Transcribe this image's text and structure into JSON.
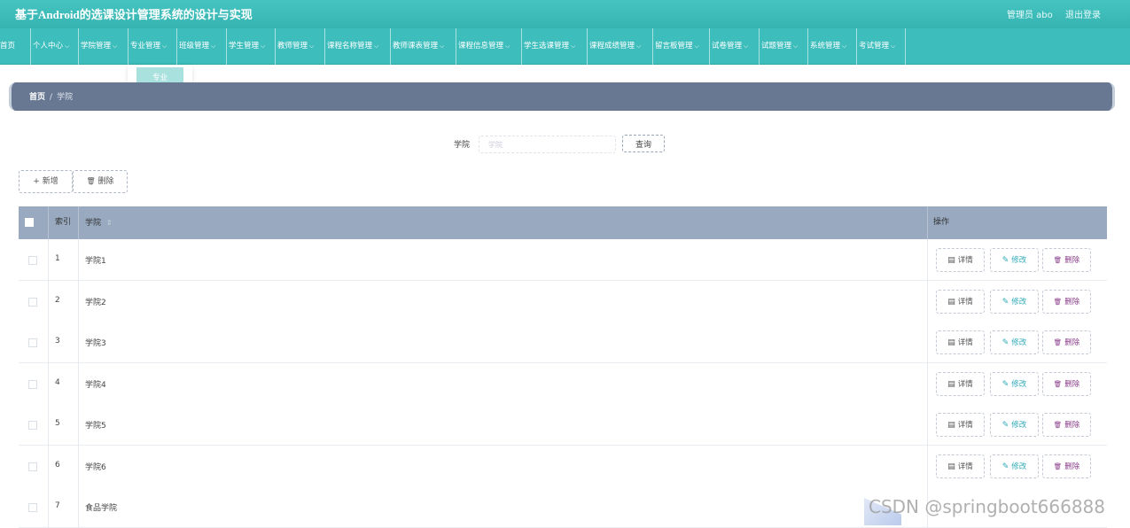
{
  "app": {
    "title": "基于Android的选课设计管理系统的设计与实现",
    "user_label": "管理员 abo",
    "logout_label": "退出登录"
  },
  "nav": {
    "items": [
      {
        "label": "首页",
        "has_dropdown": false
      },
      {
        "label": "个人中心",
        "has_dropdown": true
      },
      {
        "label": "学院管理",
        "has_dropdown": true
      },
      {
        "label": "专业管理",
        "has_dropdown": true
      },
      {
        "label": "班级管理",
        "has_dropdown": true
      },
      {
        "label": "学生管理",
        "has_dropdown": true
      },
      {
        "label": "教师管理",
        "has_dropdown": true
      },
      {
        "label": "课程名称管理",
        "has_dropdown": true
      },
      {
        "label": "教师课表管理",
        "has_dropdown": true
      },
      {
        "label": "课程信息管理",
        "has_dropdown": true
      },
      {
        "label": "学生选课管理",
        "has_dropdown": true
      },
      {
        "label": "课程成绩管理",
        "has_dropdown": true
      },
      {
        "label": "留言板管理",
        "has_dropdown": true
      },
      {
        "label": "试卷管理",
        "has_dropdown": true
      },
      {
        "label": "试题管理",
        "has_dropdown": true
      },
      {
        "label": "系统管理",
        "has_dropdown": true
      },
      {
        "label": "考试管理",
        "has_dropdown": true
      }
    ],
    "chevron": "⌵",
    "open_dropdown": {
      "item_label": "专业"
    }
  },
  "breadcrumb": {
    "home": "首页",
    "separator": "/",
    "current": "学院"
  },
  "search": {
    "label": "学院",
    "placeholder": "学院",
    "button_label": "查询"
  },
  "toolbar": {
    "add_label": "新增",
    "add_icon": "+",
    "delete_label": "删除",
    "delete_icon": "🗑"
  },
  "table": {
    "columns": {
      "index": "索引",
      "name": "学院",
      "actions": "操作"
    },
    "sort_icon": "⇕",
    "rows": [
      {
        "index": "1",
        "name": "学院1"
      },
      {
        "index": "2",
        "name": "学院2"
      },
      {
        "index": "3",
        "name": "学院3"
      },
      {
        "index": "4",
        "name": "学院4"
      },
      {
        "index": "5",
        "name": "学院5"
      },
      {
        "index": "6",
        "name": "学院6"
      },
      {
        "index": "7",
        "name": "食品学院"
      }
    ],
    "row_actions": {
      "detail": "详情",
      "detail_icon": "▤",
      "edit": "修改",
      "edit_icon": "✎",
      "delete": "删除",
      "delete_icon": "🗑"
    }
  },
  "watermark": "CSDN @springboot666888",
  "colors": {
    "header_teal": "#3dbdbb",
    "breadcrumb_bar": "#687892",
    "table_header": "#98a9c0",
    "edit_accent": "#2ea9b8",
    "delete_accent": "#8a3d8a"
  }
}
